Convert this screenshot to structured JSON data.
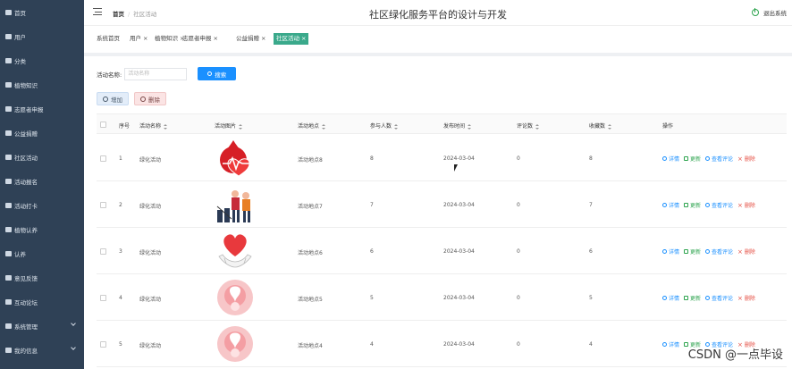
{
  "sidebar": {
    "items": [
      {
        "label": "首页",
        "icon": "home-icon"
      },
      {
        "label": "用户",
        "icon": "user-icon"
      },
      {
        "label": "分类",
        "icon": "category-icon"
      },
      {
        "label": "植物知识",
        "icon": "plant-icon"
      },
      {
        "label": "志愿者申报",
        "icon": "volunteer-icon"
      },
      {
        "label": "公益捐赠",
        "icon": "donation-icon"
      },
      {
        "label": "社区活动",
        "icon": "activity-icon"
      },
      {
        "label": "活动报名",
        "icon": "signup-icon"
      },
      {
        "label": "活动打卡",
        "icon": "checkin-icon"
      },
      {
        "label": "植物认养",
        "icon": "adopt-icon"
      },
      {
        "label": "认养",
        "icon": "adopt2-icon"
      },
      {
        "label": "意见反馈",
        "icon": "feedback-icon"
      },
      {
        "label": "互动论坛",
        "icon": "forum-icon"
      },
      {
        "label": "系统管理",
        "icon": "system-icon"
      },
      {
        "label": "我的信息",
        "icon": "profile-icon"
      }
    ]
  },
  "header": {
    "breadcrumb": [
      "首页",
      "社区活动"
    ],
    "title": "社区绿化服务平台的设计与开发",
    "logout": "退出系统"
  },
  "tags": [
    "系统首页",
    "用户",
    "植物知识",
    "志愿者申报",
    "公益捐赠",
    "社区活动"
  ],
  "search": {
    "label": "活动名称:",
    "placeholder": "活动名称",
    "button": "搜索"
  },
  "actions": {
    "add": "增加",
    "delete": "删除"
  },
  "table": {
    "headers": [
      "序号",
      "活动名称",
      "活动图片",
      "活动地点",
      "参与人数",
      "发布时间",
      "评论数",
      "收藏数",
      "操作"
    ],
    "rows": [
      {
        "no": "1",
        "name": "绿化活动",
        "image": "heart-pulse",
        "place": "活动地点8",
        "people": "8",
        "time": "2024-03-04",
        "comments": "0",
        "favs": "8"
      },
      {
        "no": "2",
        "name": "绿化活动",
        "image": "volunteers",
        "place": "活动地点7",
        "people": "7",
        "time": "2024-03-04",
        "comments": "0",
        "favs": "7"
      },
      {
        "no": "3",
        "name": "绿化活动",
        "image": "heart-hands",
        "place": "活动地点6",
        "people": "6",
        "time": "2024-03-04",
        "comments": "0",
        "favs": "6"
      },
      {
        "no": "4",
        "name": "绿化活动",
        "image": "pink-ribbon",
        "place": "活动地点5",
        "people": "5",
        "time": "2024-03-04",
        "comments": "0",
        "favs": "5"
      },
      {
        "no": "5",
        "name": "绿化活动",
        "image": "pink-ribbon",
        "place": "活动地点4",
        "people": "4",
        "time": "2024-03-04",
        "comments": "0",
        "favs": "4"
      }
    ],
    "ops": {
      "detail": "详情",
      "update": "更新",
      "comments": "查看评论",
      "delete": "删除"
    }
  },
  "watermark": "CSDN @一点毕设",
  "colors": {
    "sidebar": "#2f4156",
    "activeTag": "#3aa98b",
    "primary": "#1a90ff",
    "danger": "#e54d42",
    "success": "#2ea44f"
  }
}
